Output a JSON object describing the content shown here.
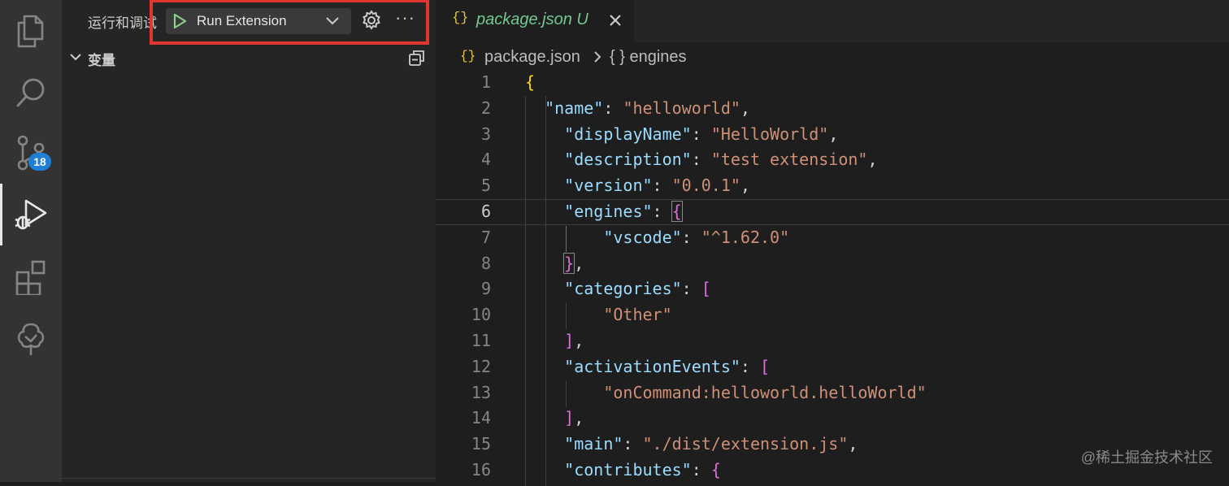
{
  "activity_bar": {
    "items": [
      {
        "name": "explorer",
        "icon": "files-icon"
      },
      {
        "name": "search",
        "icon": "search-icon"
      },
      {
        "name": "source-control",
        "icon": "source-control-icon",
        "badge": "18"
      },
      {
        "name": "run-and-debug",
        "icon": "run-debug-icon",
        "active": true
      },
      {
        "name": "extensions",
        "icon": "extensions-icon"
      },
      {
        "name": "remote-explorer",
        "icon": "tree-icon"
      }
    ]
  },
  "sidebar": {
    "title": "运行和调试",
    "launch_config": "Run Extension",
    "more": "···",
    "section_title": "变量"
  },
  "editor": {
    "tab": {
      "icon": "{}",
      "label": "package.json U"
    },
    "breadcrumb": {
      "icon": "{}",
      "file": "package.json",
      "symbol": "{ } engines"
    },
    "active_line": 6,
    "lines": [
      {
        "n": "1",
        "text": "{"
      },
      {
        "n": "2",
        "text": "  \"name\": \"helloworld\","
      },
      {
        "n": "3",
        "text": "    \"displayName\": \"HelloWorld\","
      },
      {
        "n": "4",
        "text": "    \"description\": \"test extension\","
      },
      {
        "n": "5",
        "text": "    \"version\": \"0.0.1\","
      },
      {
        "n": "6",
        "text": "    \"engines\": {"
      },
      {
        "n": "7",
        "text": "        \"vscode\": \"^1.62.0\""
      },
      {
        "n": "8",
        "text": "    },"
      },
      {
        "n": "9",
        "text": "    \"categories\": ["
      },
      {
        "n": "10",
        "text": "        \"Other\""
      },
      {
        "n": "11",
        "text": "    ],"
      },
      {
        "n": "12",
        "text": "    \"activationEvents\": ["
      },
      {
        "n": "13",
        "text": "        \"onCommand:helloworld.helloWorld\""
      },
      {
        "n": "14",
        "text": "    ],"
      },
      {
        "n": "15",
        "text": "    \"main\": \"./dist/extension.js\","
      },
      {
        "n": "16",
        "text": "    \"contributes\": {"
      }
    ]
  },
  "watermark": "@稀土掘金技术社区",
  "colors": {
    "activity_bar": "#333333",
    "sidebar": "#252526",
    "editor": "#1e1e1e",
    "highlight_box": "#e0362f",
    "badge": "#1f7fd6",
    "json_key": "#9cdcfe",
    "json_string": "#ce9178",
    "untracked_tab": "#73c991"
  }
}
